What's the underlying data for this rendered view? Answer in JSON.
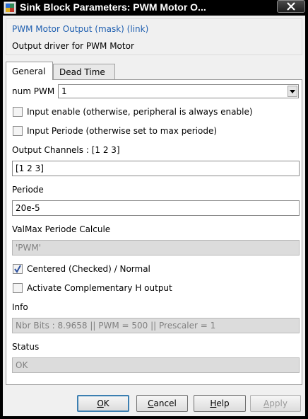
{
  "window": {
    "title": "Sink Block Parameters: PWM Motor O..."
  },
  "block": {
    "title": "PWM Motor Output (mask) (link)",
    "description": "Output driver for PWM Motor"
  },
  "tabs": [
    {
      "label": "General",
      "active": true
    },
    {
      "label": "Dead Time",
      "active": false
    }
  ],
  "general": {
    "num_pwm": {
      "label": "num PWM",
      "value": "1"
    },
    "input_enable": {
      "label": "Input enable (otherwise, peripheral is always enable)",
      "checked": false
    },
    "input_periode": {
      "label": "Input Periode (otherwise set to  max periode)",
      "checked": false
    },
    "output_channels": {
      "label": "Output Channels : [1  2  3]",
      "value": "[1 2 3]"
    },
    "periode": {
      "label": "Periode",
      "value": "20e-5"
    },
    "valmax": {
      "label": "ValMax Periode Calcule",
      "value": "'PWM'"
    },
    "centered": {
      "label": "Centered (Checked) / Normal",
      "checked": true
    },
    "complementary": {
      "label": "Activate Complementary H output",
      "checked": false
    },
    "info": {
      "label": "Info",
      "value": "Nbr Bits : 8.9658  ||  PWM = 500  ||  Prescaler = 1"
    },
    "status": {
      "label": "Status",
      "value": "OK"
    }
  },
  "buttons": {
    "ok": {
      "pre": "",
      "key": "O",
      "post": "K"
    },
    "cancel": {
      "pre": "",
      "key": "C",
      "post": "ancel"
    },
    "help": {
      "pre": "",
      "key": "H",
      "post": "elp"
    },
    "apply": {
      "pre": "",
      "key": "A",
      "post": "pply"
    }
  },
  "colors": {
    "group_title": "#1f5fb0",
    "check_mark": "#2b4f9e"
  }
}
